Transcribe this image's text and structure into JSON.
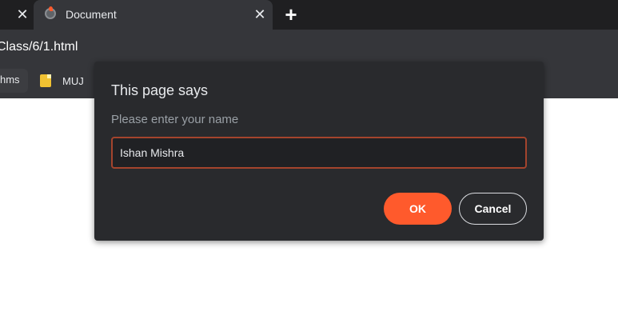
{
  "tabs": {
    "active_title": "Document",
    "close_glyph": "✕",
    "new_tab_glyph": "+"
  },
  "address_bar": {
    "url_fragment": "Class/6/1.html"
  },
  "bookmarks": {
    "left_partial": "hms",
    "muj_label": "MUJ",
    "muj_icon": "folder-icon"
  },
  "dialog": {
    "title": "This page says",
    "message": "Please enter your name",
    "input_value": "Ishan Mishra",
    "ok_label": "OK",
    "cancel_label": "Cancel",
    "accent_color": "#ff5a2c"
  }
}
